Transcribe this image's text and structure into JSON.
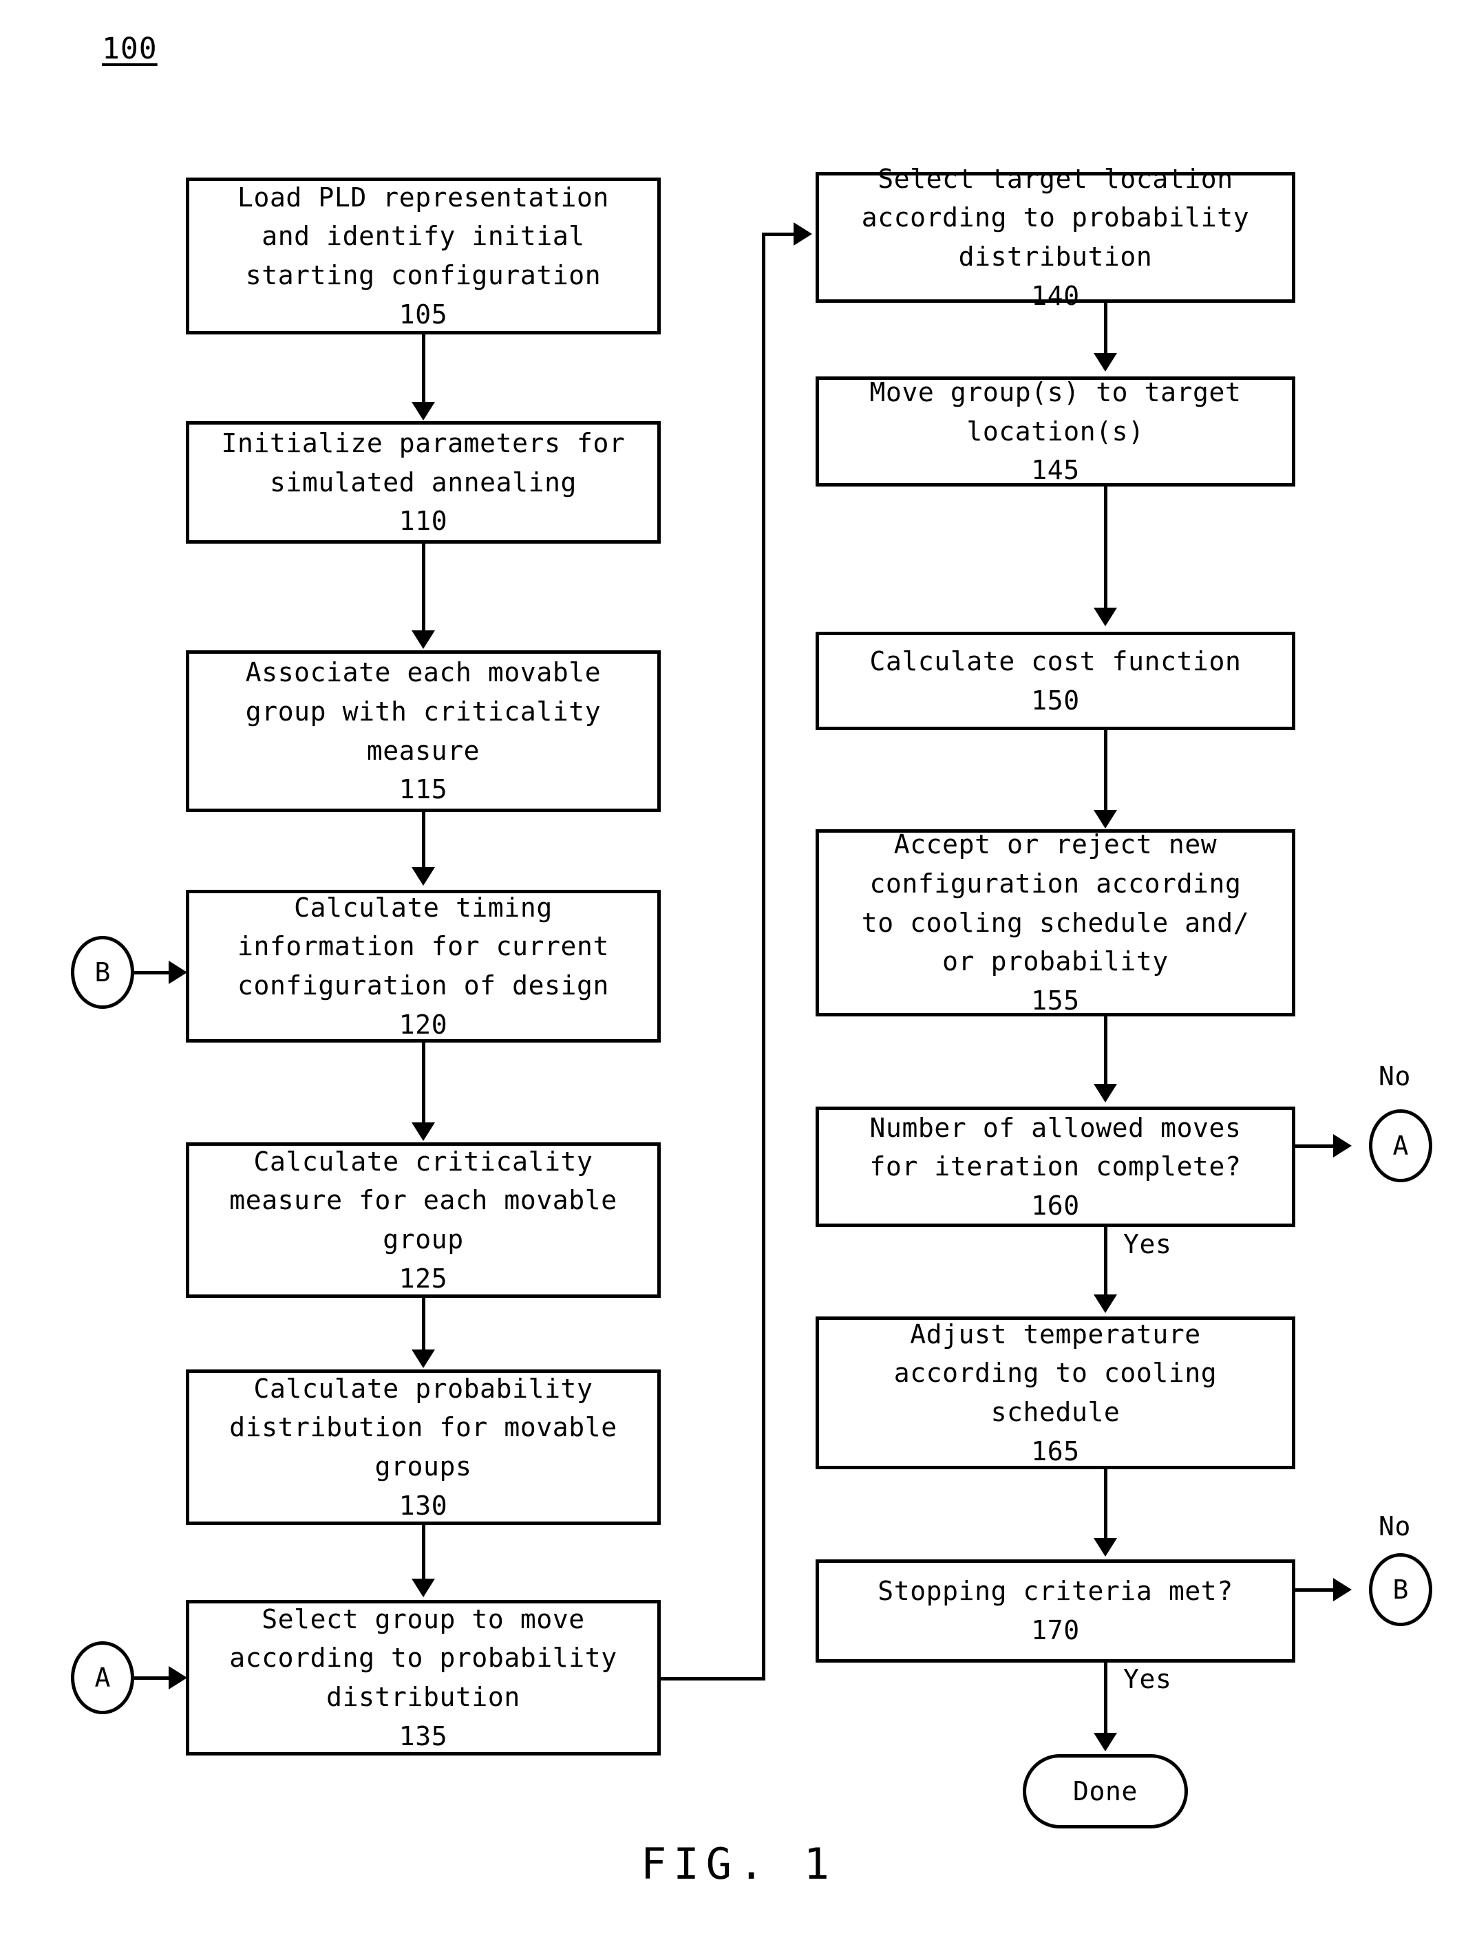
{
  "figure": {
    "number": "100",
    "caption": "FIG. 1"
  },
  "boxes": {
    "b105": {
      "lines": [
        "Load PLD representation",
        "and identify initial",
        "starting configuration",
        "105"
      ],
      "ref": "105"
    },
    "b110": {
      "lines": [
        "Initialize parameters for",
        "simulated annealing",
        "110"
      ],
      "ref": "110"
    },
    "b115": {
      "lines": [
        "Associate each movable",
        "group with criticality",
        "measure",
        "115"
      ],
      "ref": "115"
    },
    "b120": {
      "lines": [
        "Calculate timing",
        "information for current",
        "configuration of design",
        "120"
      ],
      "ref": "120"
    },
    "b125": {
      "lines": [
        "Calculate criticality",
        "measure for each movable",
        "group",
        "125"
      ],
      "ref": "125"
    },
    "b130": {
      "lines": [
        "Calculate probability",
        "distribution for movable",
        "groups",
        "130"
      ],
      "ref": "130"
    },
    "b135": {
      "lines": [
        "Select group to move",
        "according to probability",
        "distribution",
        "135"
      ],
      "ref": "135"
    },
    "b140": {
      "lines": [
        "Select target location",
        "according to probability",
        "distribution",
        "140"
      ],
      "ref": "140"
    },
    "b145": {
      "lines": [
        "Move group(s) to target",
        "location(s)",
        "145"
      ],
      "ref": "145"
    },
    "b150": {
      "lines": [
        "Calculate cost function",
        "150"
      ],
      "ref": "150"
    },
    "b155": {
      "lines": [
        "Accept or reject new",
        "configuration according",
        "to cooling schedule and/",
        "or probability",
        "155"
      ],
      "ref": "155"
    },
    "b160": {
      "lines": [
        "Number of allowed moves",
        "for iteration complete?",
        "160"
      ],
      "ref": "160"
    },
    "b165": {
      "lines": [
        "Adjust temperature",
        "according to cooling",
        "schedule",
        "165"
      ],
      "ref": "165"
    },
    "b170": {
      "lines": [
        "Stopping criteria met?",
        "170"
      ],
      "ref": "170"
    },
    "done": {
      "label": "Done"
    }
  },
  "connectors": {
    "b_left": "B",
    "a_left": "A",
    "a_right": "A",
    "b_right": "B"
  },
  "edge_labels": {
    "no_160": "No",
    "yes_160": "Yes",
    "no_170": "No",
    "yes_170": "Yes"
  },
  "colors": {
    "ink": "#000000",
    "paper": "#ffffff"
  }
}
